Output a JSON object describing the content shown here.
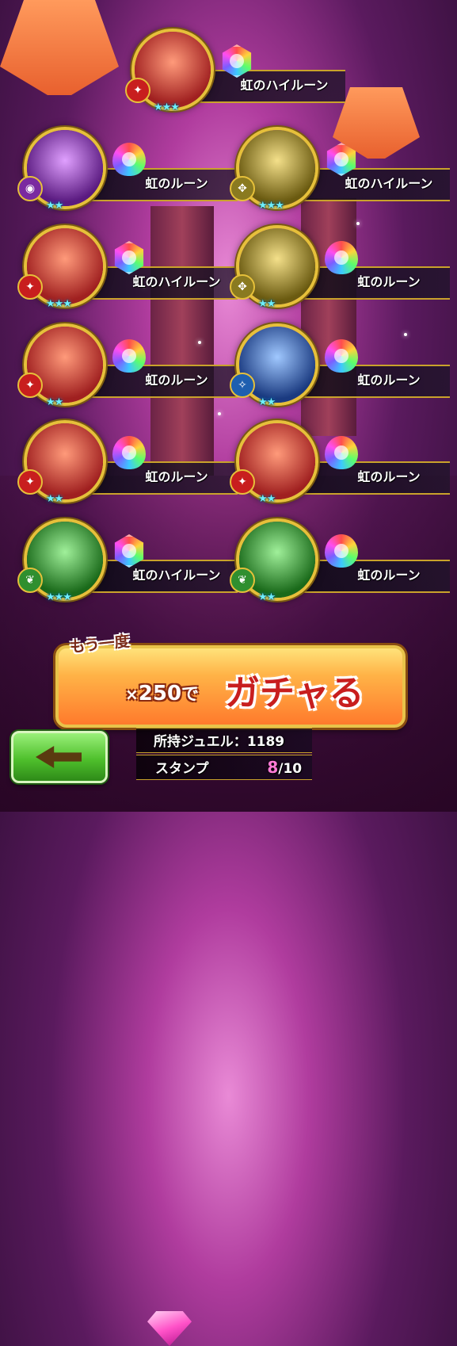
{
  "results": [
    {
      "name": "虹のハイルーン",
      "rune": "hi",
      "element": "fire",
      "stars": "★★★"
    },
    {
      "name": "虹のルーン",
      "rune": "lo",
      "element": "dark",
      "stars": "★★"
    },
    {
      "name": "虹のハイルーン",
      "rune": "hi",
      "element": "earth",
      "stars": "★★★"
    },
    {
      "name": "虹のハイルーン",
      "rune": "hi",
      "element": "fire",
      "stars": "★★★"
    },
    {
      "name": "虹のルーン",
      "rune": "lo",
      "element": "earth",
      "stars": "★★"
    },
    {
      "name": "虹のルーン",
      "rune": "lo",
      "element": "fire",
      "stars": "★★"
    },
    {
      "name": "虹のルーン",
      "rune": "lo",
      "element": "wind",
      "stars": "★★"
    },
    {
      "name": "虹のルーン",
      "rune": "lo",
      "element": "fire",
      "stars": "★★"
    },
    {
      "name": "虹のルーン",
      "rune": "lo",
      "element": "fire",
      "stars": "★★"
    },
    {
      "name": "虹のハイルーン",
      "rune": "hi",
      "element": "wood",
      "stars": "★★★"
    },
    {
      "name": "虹のルーン",
      "rune": "lo",
      "element": "wood",
      "stars": "★★"
    }
  ],
  "retry": {
    "tag": "もう一度",
    "times": "×",
    "cost": "250",
    "de": "で",
    "action": "ガチャる"
  },
  "info": {
    "jewel_label": "所持ジュエル：",
    "jewel_value": "1189",
    "stamp_label": "スタンプ",
    "stamp_count": "8",
    "stamp_total": "/10"
  },
  "colors": {
    "gold": "#e6c03a",
    "star": "#6ef0ff",
    "button_orange": "#ff7a2c",
    "back_green": "#4fc02c",
    "stamp_pink": "#ff7ad6"
  },
  "icons": {
    "back": "left-arrow-icon",
    "gem": "pink-jewel-icon"
  }
}
